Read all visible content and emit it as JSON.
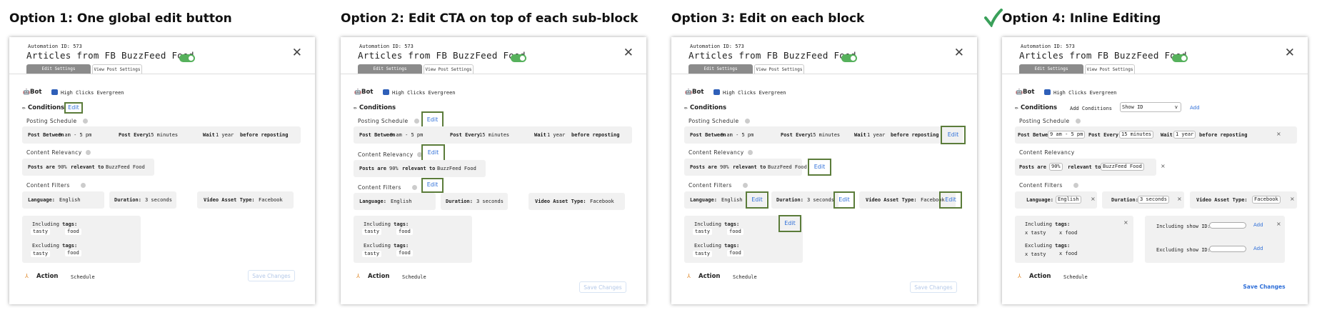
{
  "headings": [
    "Option 1: One global edit button",
    "Option 2: Edit CTA on top of each sub-block",
    "Option 3: Edit on each block",
    "Option 4: Inline Editing"
  ],
  "colors": {
    "toggle": "#56b15c",
    "highlight": "#5b7c3a",
    "link": "#2f6fd8",
    "check": "#3aa05a"
  },
  "common": {
    "automation_id": "Automation ID: 573",
    "title": "Articles from FB BuzzFeed Food",
    "tab_edit": "Edit Settings",
    "tab_view": "View Post Settings",
    "bot": "Bot",
    "bot_value": "High Clicks Evergreen",
    "conditions": "Conditions",
    "posting_schedule": "Posting Schedule",
    "post_between": "Post Between",
    "post_between_value": "9 am - 5 pm",
    "post_every": "Post Every",
    "post_every_value": "15 minutes",
    "wait": "Wait",
    "wait_value": "1 year",
    "before_reposting": "before reposting",
    "content_relevancy": "Content Relevancy",
    "posts_are": "Posts are",
    "percent": "90%",
    "relevant_to": "relevant to",
    "source": "BuzzFeed Food",
    "content_filters": "Content Filters",
    "language": "Language:",
    "language_value": "English",
    "duration": "Duration:",
    "duration_value": "3 seconds",
    "video_asset_type": "Video Asset Type:",
    "video_asset_value": "Facebook",
    "including": "Including",
    "excluding": "Excluding",
    "tags": "tags:",
    "tag1": "tasty",
    "tag2": "food",
    "action": "Action",
    "action_value": "Schedule",
    "save": "Save Changes",
    "edit": "Edit"
  },
  "option4": {
    "add_conditions": "Add Conditions",
    "show_id": "Show ID",
    "add": "Add",
    "post_between_sel": "9 am - 5 pm",
    "post_every_sel": "15 minutes",
    "wait_sel": "1 year",
    "percent_sel": "90%",
    "source_sel": "BuzzFeed Food",
    "language_sel": "English",
    "duration_sel": "3 seconds",
    "video_sel": "Facebook",
    "tag1": "x tasty",
    "tag2": "x food",
    "including_show_id": "Including show ID:",
    "excluding_show_id": "Excluding show ID:"
  }
}
